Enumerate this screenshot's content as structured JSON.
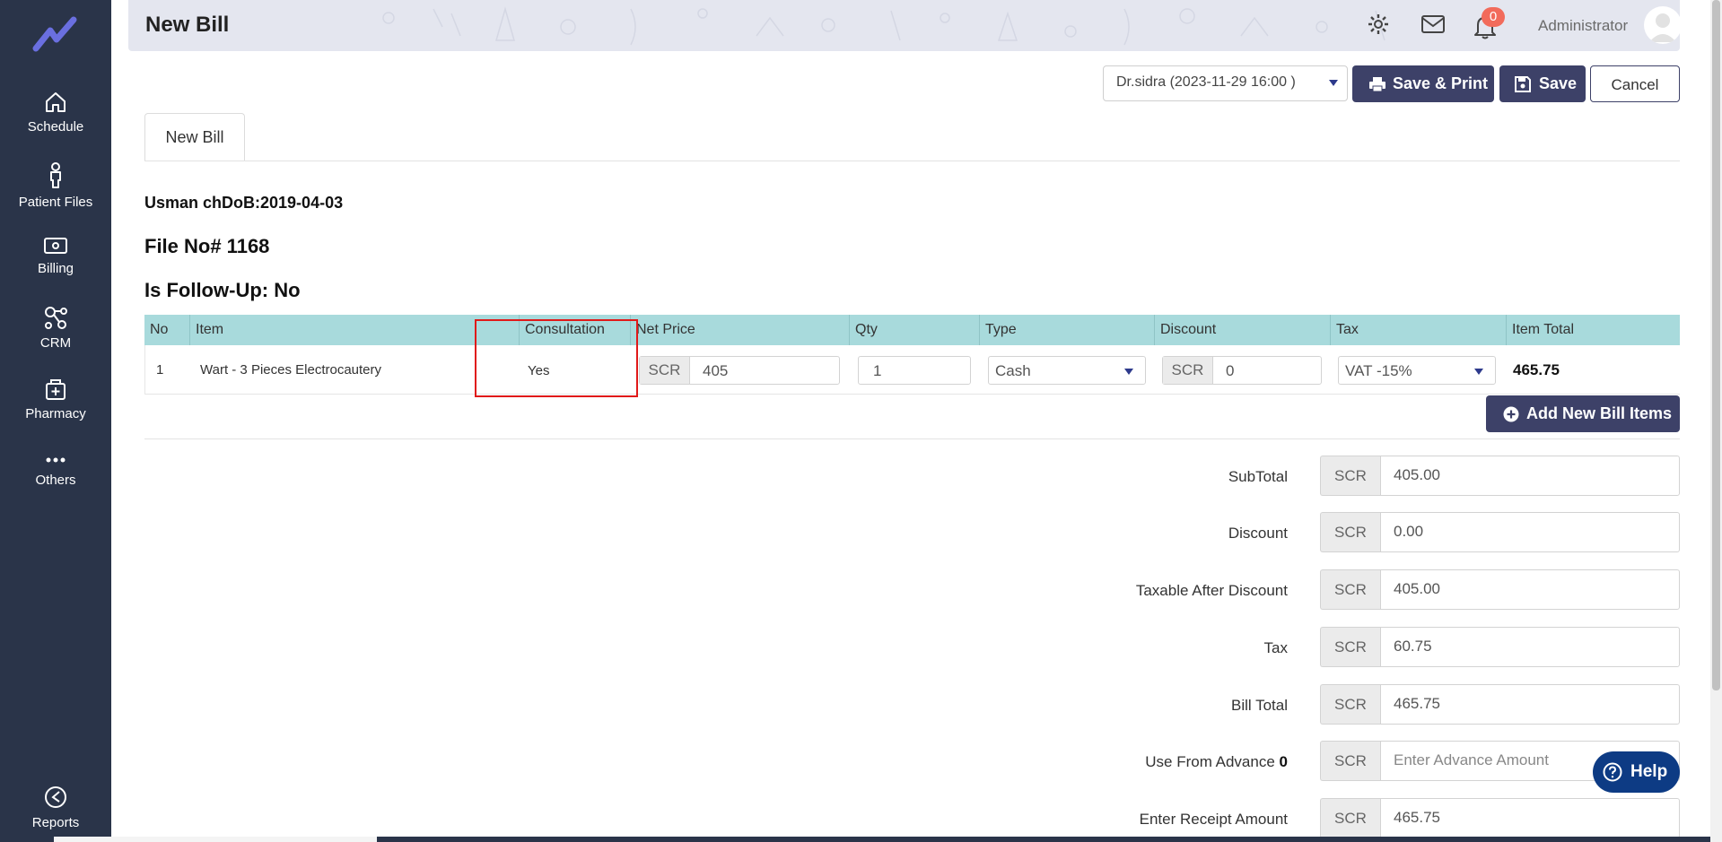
{
  "sidebar": {
    "items": [
      {
        "label": "Schedule",
        "icon": "home-icon"
      },
      {
        "label": "Patient Files",
        "icon": "person-icon"
      },
      {
        "label": "Billing",
        "icon": "billing-icon"
      },
      {
        "label": "CRM",
        "icon": "crm-icon"
      },
      {
        "label": "Pharmacy",
        "icon": "pharmacy-icon"
      },
      {
        "label": "Others",
        "icon": "more-icon"
      },
      {
        "label": "Reports",
        "icon": "reports-icon"
      }
    ]
  },
  "header": {
    "title": "New Bill",
    "notification_count": "0",
    "user_name": "Administrator"
  },
  "toolbar": {
    "doctor_select": "Dr.sidra (2023-11-29 16:00 )",
    "save_print_label": "Save & Print",
    "save_label": "Save",
    "cancel_label": "Cancel"
  },
  "tabs": [
    {
      "label": "New Bill"
    }
  ],
  "patient": {
    "name_dob": "Usman chDoB:2019-04-03",
    "file_no": "File No# 1168",
    "follow_up": "Is Follow-Up: No"
  },
  "table": {
    "columns": [
      "No",
      "Item",
      "Consultation",
      "Net Price",
      "Qty",
      "Type",
      "Discount",
      "Tax",
      "Item Total"
    ],
    "rows": [
      {
        "no": "1",
        "item": "Wart - 3 Pieces Electrocautery",
        "consultation": "Yes",
        "currency": "SCR",
        "net_price": "405",
        "qty": "1",
        "type": "Cash",
        "discount_currency": "SCR",
        "discount": "0",
        "tax": "VAT -15%",
        "item_total": "465.75"
      }
    ]
  },
  "add_item_label": "Add New Bill Items",
  "summary": [
    {
      "label": "SubTotal",
      "currency": "SCR",
      "value": "405.00"
    },
    {
      "label": "Discount",
      "currency": "SCR",
      "value": "0.00"
    },
    {
      "label": "Taxable After Discount",
      "currency": "SCR",
      "value": "405.00"
    },
    {
      "label": "Tax",
      "currency": "SCR",
      "value": "60.75"
    },
    {
      "label": "Bill Total",
      "currency": "SCR",
      "value": "465.75"
    },
    {
      "label": "Use From Advance",
      "label_value": "0",
      "currency": "SCR",
      "value": "",
      "placeholder": "Enter Advance Amount"
    },
    {
      "label": "Enter Receipt Amount",
      "currency": "SCR",
      "value": "465.75"
    }
  ],
  "help_label": "Help",
  "colors": {
    "sidebar": "#2a3449",
    "primary_button": "#3d4168",
    "table_header": "#a8dadc",
    "highlight": "#e01919",
    "badge": "#f26b5b",
    "help": "#0d3b84"
  }
}
